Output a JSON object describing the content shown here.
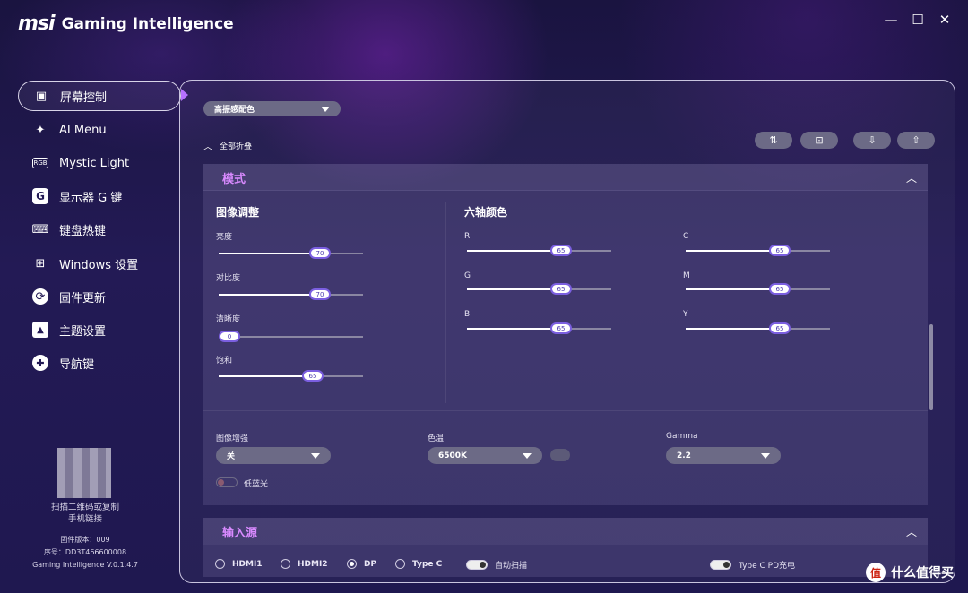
{
  "app": {
    "brand": "msi",
    "title": "Gaming Intelligence"
  },
  "window_controls": {
    "minimize": "—",
    "maximize": "☐",
    "close": "✕"
  },
  "sidebar": {
    "items": [
      {
        "label": "屏幕控制",
        "icon": "monitor-icon",
        "glyph": "▣"
      },
      {
        "label": "AI Menu",
        "icon": "ai-icon",
        "glyph": "✦"
      },
      {
        "label": "Mystic Light",
        "icon": "rgb-icon",
        "glyph": "RGB"
      },
      {
        "label": "显示器 G 键",
        "icon": "g-key-icon",
        "glyph": "G"
      },
      {
        "label": "键盘热键",
        "icon": "keyboard-icon",
        "glyph": "⌨"
      },
      {
        "label": "Windows 设置",
        "icon": "windows-icon",
        "glyph": "⊞"
      },
      {
        "label": "固件更新",
        "icon": "firmware-icon",
        "glyph": "⟳"
      },
      {
        "label": "主题设置",
        "icon": "theme-icon",
        "glyph": "▲"
      },
      {
        "label": "导航键",
        "icon": "navigation-icon",
        "glyph": "✚"
      }
    ],
    "qr_caption": "扫描二维码或复制",
    "qr_caption2": "手机链接",
    "firmware_version": "固件版本：009",
    "serial": "序号：DD3T466600008",
    "app_version": "Gaming Intelligence V.0.1.4.7"
  },
  "toolbar": {
    "profile_select": "高振感配色",
    "collapse_all": "全部折叠",
    "tools": [
      "⇅",
      "⊡",
      "⇩",
      "⇧"
    ]
  },
  "mode_section": {
    "title": "模式",
    "image_adjust": {
      "title": "图像调整",
      "sliders": [
        {
          "label": "亮度",
          "value": "70",
          "level": 70
        },
        {
          "label": "对比度",
          "value": "70",
          "level": 70
        },
        {
          "label": "清晰度",
          "value": "0",
          "level": 0
        },
        {
          "label": "饱和",
          "value": "65",
          "level": 65
        }
      ]
    },
    "six_axis": {
      "title": "六轴颜色",
      "left": [
        {
          "label": "R",
          "value": "65",
          "level": 65
        },
        {
          "label": "G",
          "value": "65",
          "level": 65
        },
        {
          "label": "B",
          "value": "65",
          "level": 65
        }
      ],
      "right": [
        {
          "label": "C",
          "value": "65",
          "level": 65
        },
        {
          "label": "M",
          "value": "65",
          "level": 65
        },
        {
          "label": "Y",
          "value": "65",
          "level": 65
        }
      ]
    },
    "image_enhance": {
      "label": "图像增强",
      "value": "关"
    },
    "color_temp": {
      "label": "色温",
      "value": "6500K"
    },
    "gamma": {
      "label": "Gamma",
      "value": "2.2"
    },
    "low_blue_light": {
      "label": "低蓝光",
      "on": false
    }
  },
  "input_section": {
    "title": "输入源",
    "sources": [
      {
        "label": "HDMI1",
        "selected": false
      },
      {
        "label": "HDMI2",
        "selected": false
      },
      {
        "label": "DP",
        "selected": true
      },
      {
        "label": "Type C",
        "selected": false
      }
    ],
    "auto_scan": {
      "label": "自动扫描",
      "on": true
    },
    "typec_pd": {
      "label": "Type C PD充电",
      "on": true
    }
  },
  "watermark": {
    "badge": "值",
    "text": "什么值得买"
  }
}
